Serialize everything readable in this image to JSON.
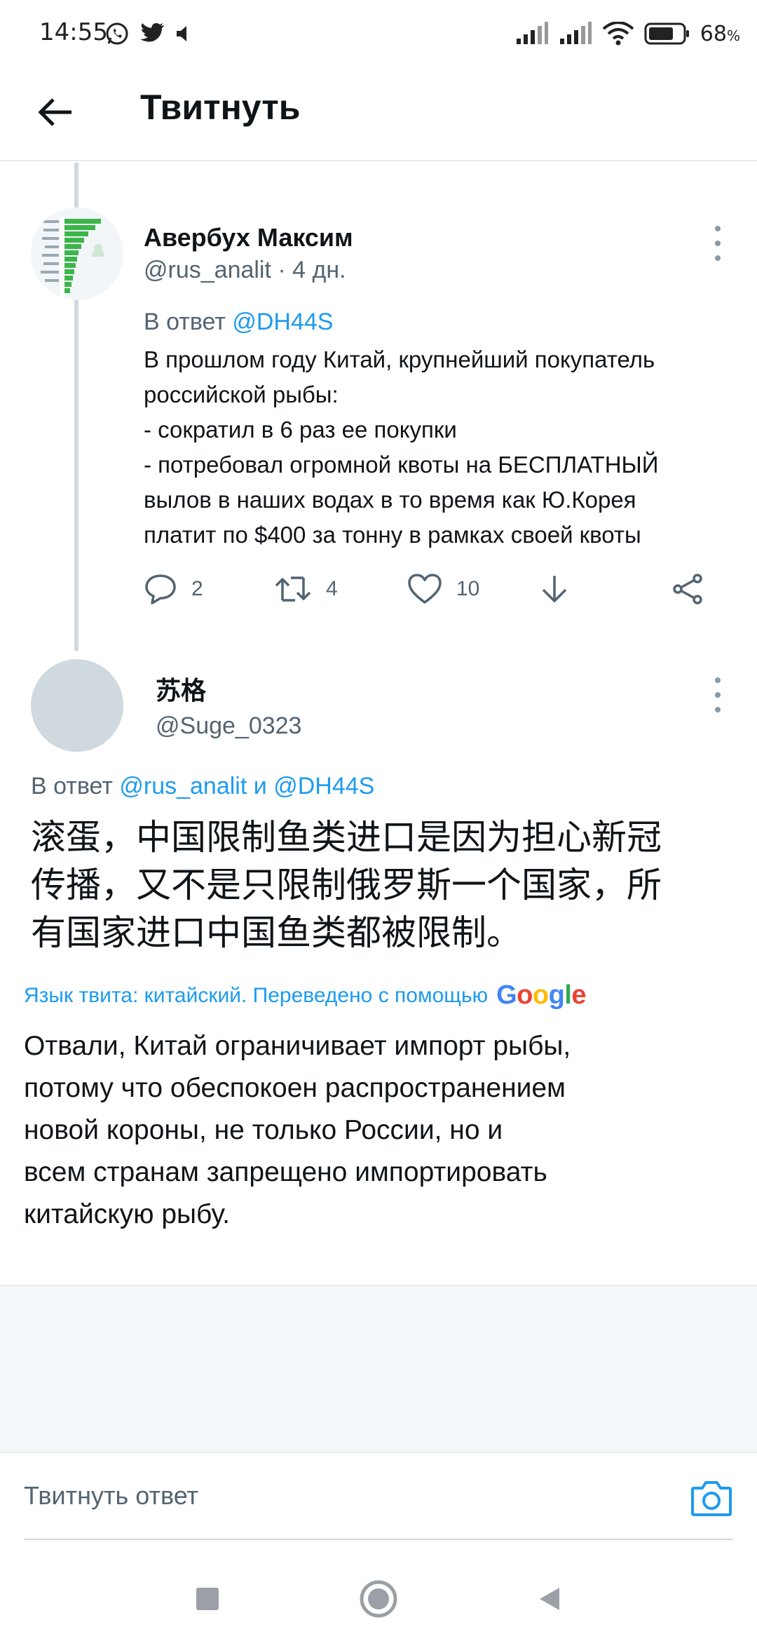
{
  "status_bar": {
    "time": "14:55",
    "left_icons": [
      "whatsapp-icon",
      "twitter-icon",
      "volume-icon"
    ],
    "right_icons": [
      "signal-icon",
      "signal-icon",
      "wifi-icon",
      "battery-icon"
    ],
    "battery": "68"
  },
  "header": {
    "title": "Твитнуть",
    "back_icon": "arrow-left-icon"
  },
  "tweet_1": {
    "author_name": "Авербух Максим",
    "handle": "@rus_analit",
    "time": "4 дн.",
    "reply_to_prefix": "В ответ",
    "reply_to": "@DH44S",
    "text_lines": [
      "В прошлом году Китай, крупнейший покупатель",
      "российской рыбы:",
      "- сократил в 6 раз ее покупки",
      "- потребовал огромной квоты на БЕСПЛАТНЫЙ",
      "вылов в наших водах в то время как Ю.Корея",
      "платит по $400 за тонну в рамках своей квоты"
    ],
    "replies": "2",
    "retweets": "4",
    "likes": "10"
  },
  "tweet_2": {
    "author_name": "苏格",
    "handle": "@Suge_0323",
    "reply_to_prefix": "В ответ",
    "reply_to_1": "@rus_analit",
    "reply_to_and": "и",
    "reply_to_2": "@DH44S",
    "original_lines": [
      "滚蛋，中国限制鱼类进口是因为担心新冠",
      "传播，又不是只限制俄罗斯一个国家，所",
      "有国家进口中国鱼类都被限制。"
    ],
    "translation_note": "Язык твита: китайский. Переведено с помощью",
    "google_logo": "Google",
    "translation_lines": [
      "Отвали, Китай ограничивает импорт рыбы,",
      "потому что обеспокоен распространением",
      "новой короны, не только России, но и",
      "всем странам запрещено импортировать",
      "китайскую рыбу."
    ]
  },
  "reply_bar": {
    "placeholder": "Твитнуть ответ",
    "camera_icon": "camera-icon"
  },
  "nav_bar": {
    "icons": [
      "square-recents-icon",
      "circle-home-icon",
      "triangle-back-icon"
    ]
  },
  "colors": {
    "accent": "#1d9bf0",
    "text": "#0f1419",
    "muted": "#536471",
    "divider": "#e6ecf0"
  }
}
